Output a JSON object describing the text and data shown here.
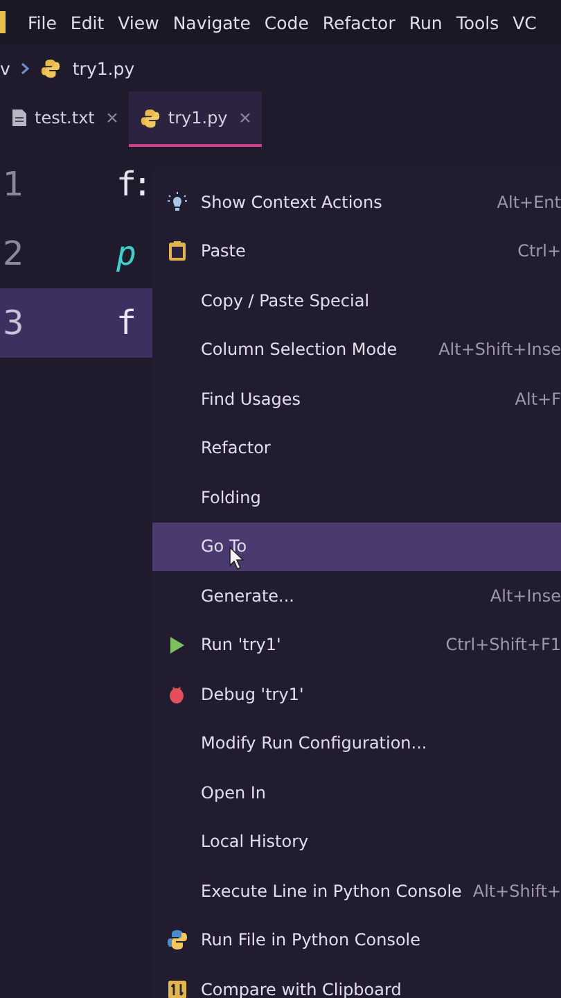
{
  "menu_bar": [
    "File",
    "Edit",
    "View",
    "Navigate",
    "Code",
    "Refactor",
    "Run",
    "Tools",
    "VC"
  ],
  "breadcrumb": {
    "parent": "v",
    "file": "try1.py"
  },
  "tabs": [
    {
      "label": "test.txt",
      "kind": "file",
      "selected": false
    },
    {
      "label": "try1.py",
      "kind": "python",
      "selected": true
    }
  ],
  "editor": {
    "lines": [
      {
        "number": "1",
        "code": "f:",
        "kind": "plain",
        "current": false
      },
      {
        "number": "2",
        "code": "p",
        "kind": "italic",
        "current": false
      },
      {
        "number": "3",
        "code": "f",
        "kind": "plain",
        "current": true
      }
    ]
  },
  "context_menu": [
    {
      "label": "Show Context Actions",
      "shortcut": "Alt+Ent",
      "kind": "bulb",
      "selected": false
    },
    {
      "label": "Paste",
      "shortcut": "Ctrl+",
      "kind": "clipboard",
      "selected": false
    },
    {
      "label": "Copy / Paste Special",
      "selected": false
    },
    {
      "label": "Column Selection Mode",
      "shortcut": "Alt+Shift+Inse",
      "selected": false
    },
    {
      "label": "Find Usages",
      "shortcut": "Alt+F",
      "selected": false
    },
    {
      "label": "Refactor",
      "selected": false
    },
    {
      "label": "Folding",
      "selected": false
    },
    {
      "label": "Go To",
      "selected": true
    },
    {
      "label": "Generate...",
      "shortcut": "Alt+Inse",
      "selected": false
    },
    {
      "label": "Run 'try1'",
      "shortcut": "Ctrl+Shift+F1",
      "kind": "run",
      "selected": false
    },
    {
      "label": "Debug 'try1'",
      "kind": "debug",
      "selected": false
    },
    {
      "label": "Modify Run Configuration...",
      "selected": false
    },
    {
      "label": "Open In",
      "selected": false
    },
    {
      "label": "Local History",
      "selected": false
    },
    {
      "label": "Execute Line in Python Console",
      "shortcut": "Alt+Shift+",
      "selected": false
    },
    {
      "label": "Run File in Python Console",
      "kind": "python",
      "selected": false
    },
    {
      "label": "Compare with Clipboard",
      "kind": "compare",
      "selected": false
    }
  ]
}
